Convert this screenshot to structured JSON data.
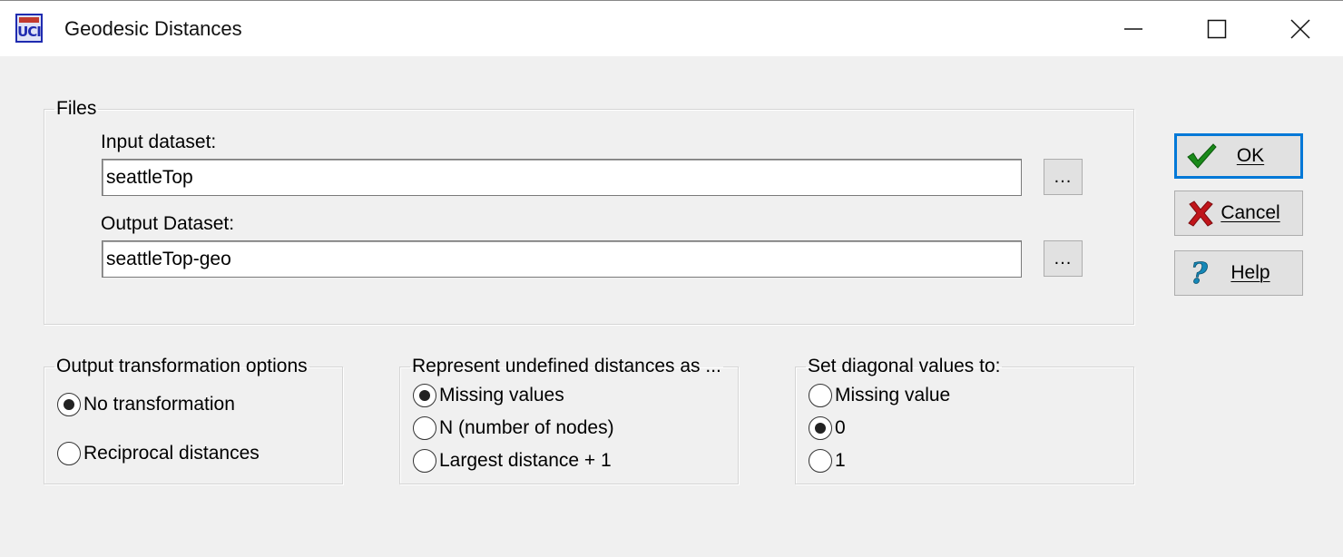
{
  "window": {
    "title": "Geodesic Distances",
    "app_icon": "ucinet-icon",
    "app_icon_text": "UCI",
    "controls": [
      "minimize-icon",
      "maximize-icon",
      "close-icon"
    ]
  },
  "files": {
    "legend": "Files",
    "input_label": "Input dataset:",
    "input_value": "seattleTop",
    "output_label": "Output Dataset:",
    "output_value": "seattleTop-geo",
    "browse_label": "..."
  },
  "buttons": {
    "ok": {
      "label": "OK",
      "icon": "checkmark-icon",
      "color": "#1a8a1a"
    },
    "cancel": {
      "label": "Cancel",
      "icon": "red-x-icon",
      "color": "#c0151a"
    },
    "help": {
      "label": "Help",
      "icon": "question-icon",
      "color": "#1588b8"
    }
  },
  "transformation": {
    "legend": "Output transformation options",
    "options": [
      {
        "label": "No transformation",
        "checked": true
      },
      {
        "label": "Reciprocal distances",
        "checked": false
      }
    ]
  },
  "undefined_distances": {
    "legend": "Represent undefined distances as ...",
    "options": [
      {
        "label": "Missing values",
        "checked": true
      },
      {
        "label": "N (number of nodes)",
        "checked": false
      },
      {
        "label": "Largest distance + 1",
        "checked": false
      }
    ]
  },
  "diagonal": {
    "legend": "Set diagonal values to:",
    "options": [
      {
        "label": "Missing value",
        "checked": false
      },
      {
        "label": "0",
        "checked": true
      },
      {
        "label": "1",
        "checked": false
      }
    ]
  }
}
